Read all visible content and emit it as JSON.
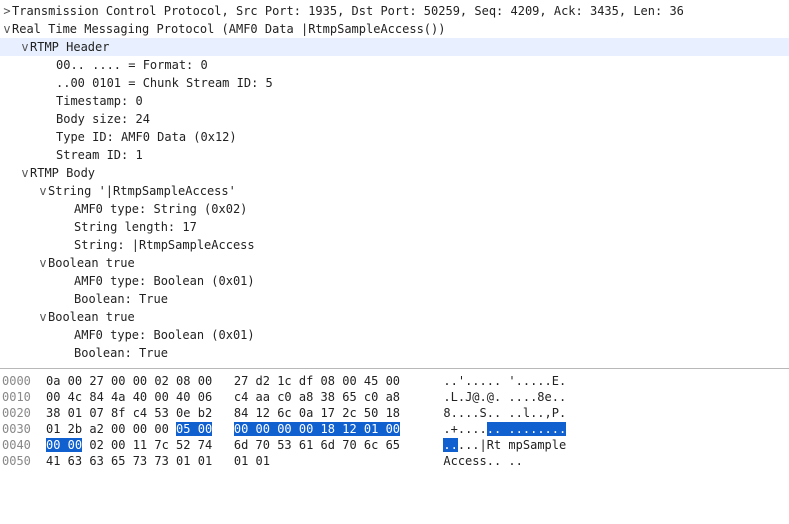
{
  "tree": {
    "tcp": {
      "chev": ">",
      "label": "Transmission Control Protocol, Src Port: 1935, Dst Port: 50259, Seq: 4209, Ack: 3435, Len: 36"
    },
    "rtmp": {
      "chev": "v",
      "label": "Real Time Messaging Protocol (AMF0 Data |RtmpSampleAccess())"
    },
    "header": {
      "chev": "v",
      "label": "RTMP Header",
      "fields": {
        "format": "00.. .... = Format: 0",
        "csid": "..00 0101 = Chunk Stream ID: 5",
        "ts": "Timestamp: 0",
        "body": "Body size: 24",
        "typeid": "Type ID: AMF0 Data (0x12)",
        "streamid": "Stream ID: 1"
      }
    },
    "body": {
      "chev": "v",
      "label": "RTMP Body",
      "string": {
        "chev": "v",
        "label": "String '|RtmpSampleAccess'",
        "amftype": "AMF0 type: String (0x02)",
        "len": "String length: 17",
        "val": "String: |RtmpSampleAccess"
      },
      "bool1": {
        "chev": "v",
        "label": "Boolean true",
        "amftype": "AMF0 type: Boolean (0x01)",
        "val": "Boolean: True"
      },
      "bool2": {
        "chev": "v",
        "label": "Boolean true",
        "amftype": "AMF0 type: Boolean (0x01)",
        "val": "Boolean: True"
      }
    }
  },
  "hex": {
    "lines": [
      {
        "off": "0000",
        "b1": "0a 00 27 00 00 02 08 00",
        "b2": "27 d2 1c df 08 00 45 00",
        "a": "..'..... '.....E."
      },
      {
        "off": "0010",
        "b1": "00 4c 84 4a 40 00 40 06",
        "b2": "c4 aa c0 a8 38 65 c0 a8",
        "a": ".L.J@.@. ....8e.."
      },
      {
        "off": "0020",
        "b1": "38 01 07 8f c4 53 0e b2",
        "b2": "84 12 6c 0a 17 2c 50 18",
        "a": "8....S.. ..l..,P."
      },
      {
        "off": "0030",
        "b1_pre": "01 2b a2 00 00 00 ",
        "b1_hl": "05 00",
        "b2_hl": "00 00 00 00 18 12 01 00",
        "a_pre": ".+....",
        "a_hl": ".. ........"
      },
      {
        "off": "0040",
        "b1_hl": "00 00",
        "b1_post": " 02 00 11 7c 52 74",
        "b2": "6d 70 53 61 6d 70 6c 65",
        "a_hl": "..",
        "a_post": "...|Rt mpSample"
      },
      {
        "off": "0050",
        "b1": "41 63 63 65 73 73 01 01",
        "b2": "01 01",
        "a": "Access.. .."
      }
    ]
  }
}
